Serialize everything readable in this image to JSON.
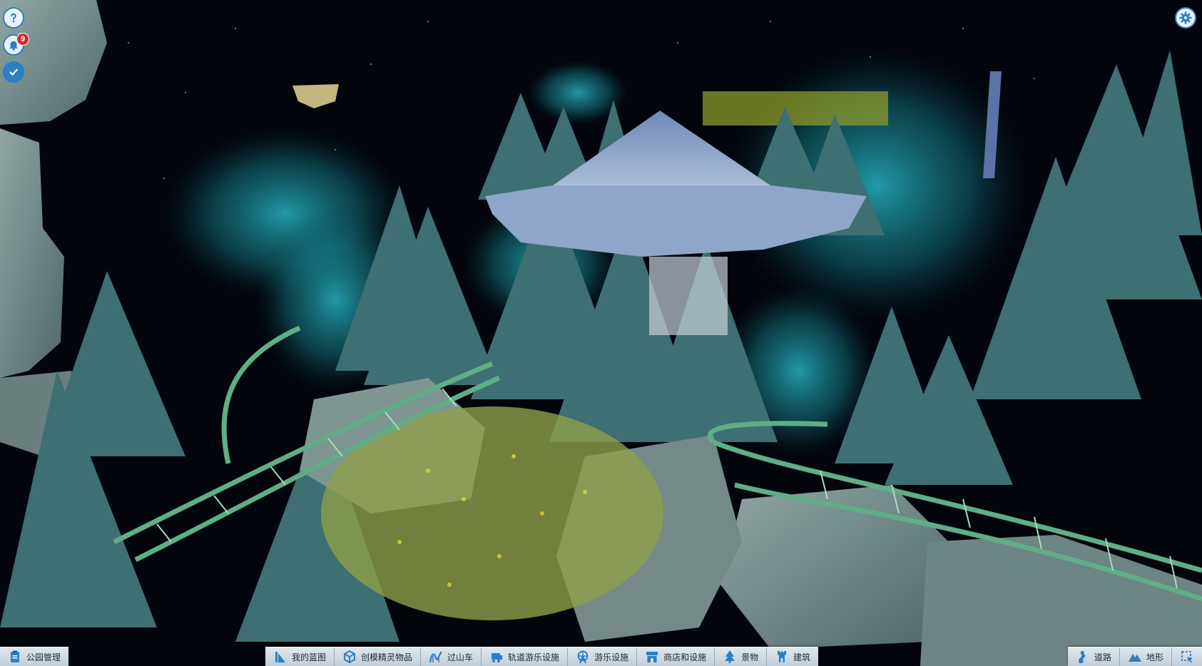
{
  "hud": {
    "notifications_count": "9",
    "help_icon": "question-icon",
    "notification_icon": "bell-icon",
    "objectives_icon": "check-icon",
    "settings_icon": "gear-icon"
  },
  "toolbar": {
    "park_management": "公园管理",
    "my_blueprints": "我的蓝图",
    "modder_items": "创模精灵物品",
    "coasters": "过山车",
    "track_rides": "轨道游乐设施",
    "flat_rides": "游乐设施",
    "shops_facilities": "商店和设施",
    "scenery": "景物",
    "construction": "建筑",
    "paths": "道路",
    "terrain": "地形"
  },
  "colors": {
    "accent": "#2b7fc4",
    "toolbar_bg": "#d3dde6",
    "badge": "#d42a2a",
    "track": "#5fae87",
    "smoke": "#1fa3b0"
  }
}
